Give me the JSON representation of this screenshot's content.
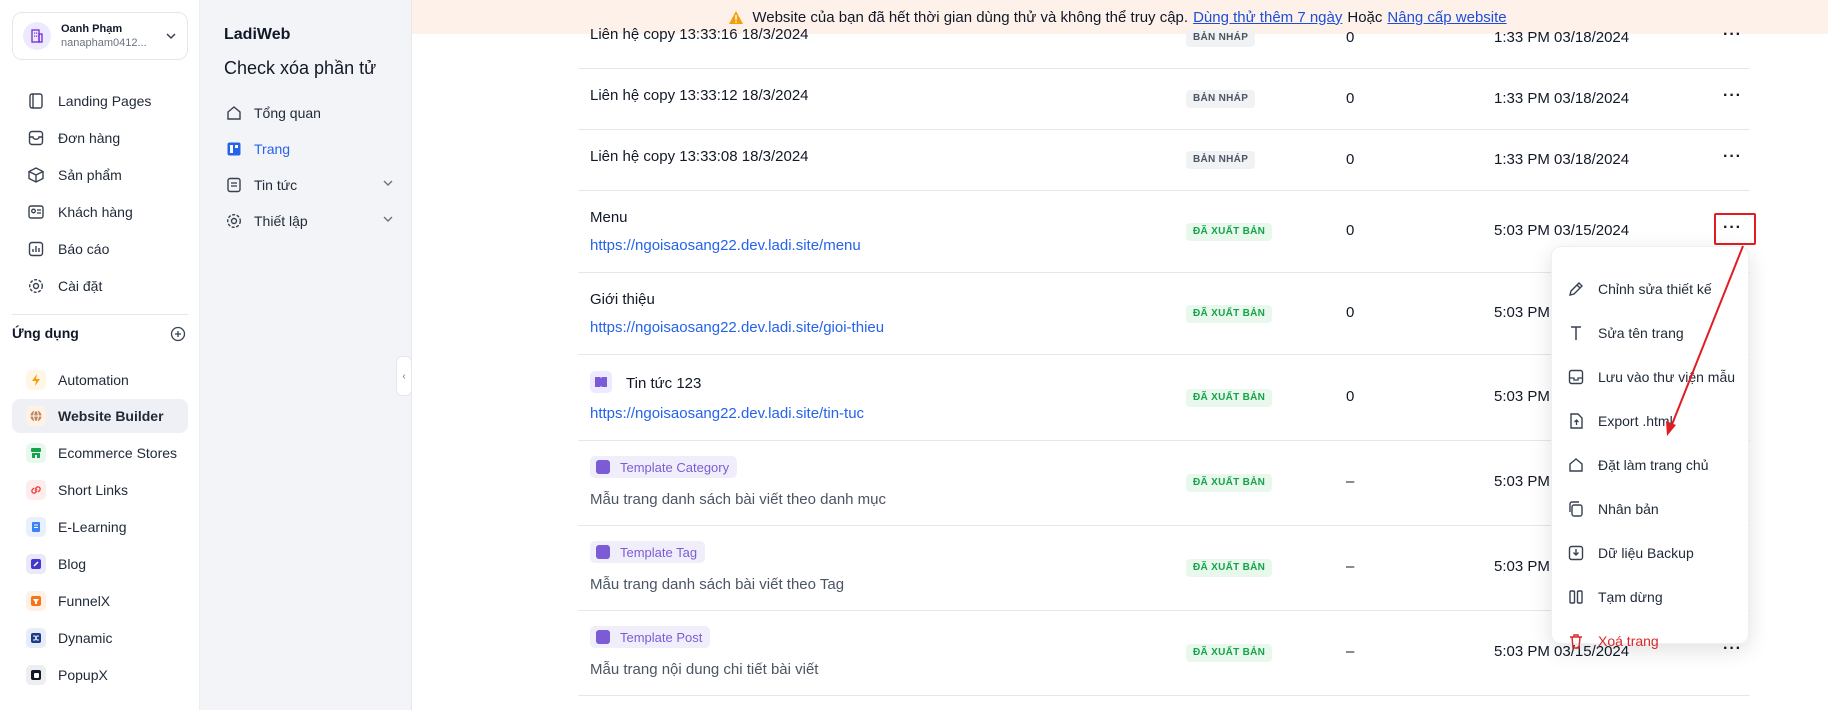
{
  "account": {
    "name": "Oanh Phạm",
    "email": "nanapham0412..."
  },
  "nav": [
    {
      "label": "Landing Pages",
      "icon": "landing-icon"
    },
    {
      "label": "Đơn hàng",
      "icon": "orders-icon"
    },
    {
      "label": "Sản phẩm",
      "icon": "box-icon"
    },
    {
      "label": "Khách hàng",
      "icon": "contact-card-icon"
    },
    {
      "label": "Báo cáo",
      "icon": "report-icon"
    },
    {
      "label": "Cài đặt",
      "icon": "gear-icon"
    }
  ],
  "apps": {
    "title": "Ứng dụng",
    "items": [
      {
        "label": "Automation",
        "color": "#f59e0b"
      },
      {
        "label": "Website Builder",
        "color": "#a16207"
      },
      {
        "label": "Ecommerce Stores",
        "color": "#16a34a"
      },
      {
        "label": "Short Links",
        "color": "#ef4444"
      },
      {
        "label": "E-Learning",
        "color": "#3b82f6"
      },
      {
        "label": "Blog",
        "color": "#4338ca"
      },
      {
        "label": "FunnelX",
        "color": "#f97316"
      },
      {
        "label": "Dynamic",
        "color": "#1e3a8a"
      },
      {
        "label": "PopupX",
        "color": "#111827"
      }
    ]
  },
  "site": {
    "brand": "LadiWeb",
    "title": "Check xóa phần tử",
    "menu": [
      {
        "label": "Tổng quan"
      },
      {
        "label": "Trang"
      },
      {
        "label": "Tin tức"
      },
      {
        "label": "Thiết lập"
      }
    ]
  },
  "banner": {
    "text": "Website của bạn đã hết thời gian dùng thử và không thể truy cập.",
    "trial_link": "Dùng thử thêm 7 ngày",
    "or": "Hoặc",
    "upgrade_link": "Nâng cấp website"
  },
  "rows": [
    {
      "name": "Liên hệ copy 13:33:16 18/3/2024",
      "badge": "BẢN NHÁP",
      "count": "0",
      "date": "1:33 PM 03/18/2024"
    },
    {
      "name": "Liên hệ copy 13:33:12 18/3/2024",
      "badge": "BẢN NHÁP",
      "count": "0",
      "date": "1:33 PM 03/18/2024"
    },
    {
      "name": "Liên hệ copy 13:33:08 18/3/2024",
      "badge": "BẢN NHÁP",
      "count": "0",
      "date": "1:33 PM 03/18/2024"
    },
    {
      "name": "Menu",
      "link": "https://ngoisaosang22.dev.ladi.site/menu",
      "badge": "ĐÃ XUẤT BẢN",
      "count": "0",
      "date": "5:03 PM 03/15/2024"
    },
    {
      "name": "Giới thiệu",
      "link": "https://ngoisaosang22.dev.ladi.site/gioi-thieu",
      "badge": "ĐÃ XUẤT BẢN",
      "count": "0",
      "date": "5:03 PM"
    },
    {
      "name": "Tin tức 123",
      "link": "https://ngoisaosang22.dev.ladi.site/tin-tuc",
      "badge": "ĐÃ XUẤT BẢN",
      "count": "0",
      "date": "5:03 PM"
    },
    {
      "tag": "Template Category",
      "desc": "Mẫu trang danh sách bài viết theo danh mục",
      "badge": "ĐÃ XUẤT BẢN",
      "count": "–",
      "date": "5:03 PM"
    },
    {
      "tag": "Template Tag",
      "desc": "Mẫu trang danh sách bài viết theo Tag",
      "badge": "ĐÃ XUẤT BẢN",
      "count": "–",
      "date": "5:03 PM"
    },
    {
      "tag": "Template Post",
      "desc": "Mẫu trang nội dung chi tiết bài viết",
      "badge": "ĐÃ XUẤT BẢN",
      "count": "–",
      "date": "5:03 PM 03/15/2024"
    }
  ],
  "more_label": "···",
  "menu": [
    {
      "label": "Chỉnh sửa thiết kế",
      "icon": "edit-design-icon"
    },
    {
      "label": "Sửa tên trang",
      "icon": "text-icon"
    },
    {
      "label": "Lưu vào thư viện mẫu",
      "icon": "save-library-icon"
    },
    {
      "label": "Export .html",
      "icon": "export-icon"
    },
    {
      "label": "Đặt làm trang chủ",
      "icon": "home-icon"
    },
    {
      "label": "Nhân bản",
      "icon": "duplicate-icon"
    },
    {
      "label": "Dữ liệu Backup",
      "icon": "backup-icon"
    },
    {
      "label": "Tạm dừng",
      "icon": "pause-icon"
    },
    {
      "label": "Xoá trang",
      "icon": "trash-icon"
    }
  ]
}
